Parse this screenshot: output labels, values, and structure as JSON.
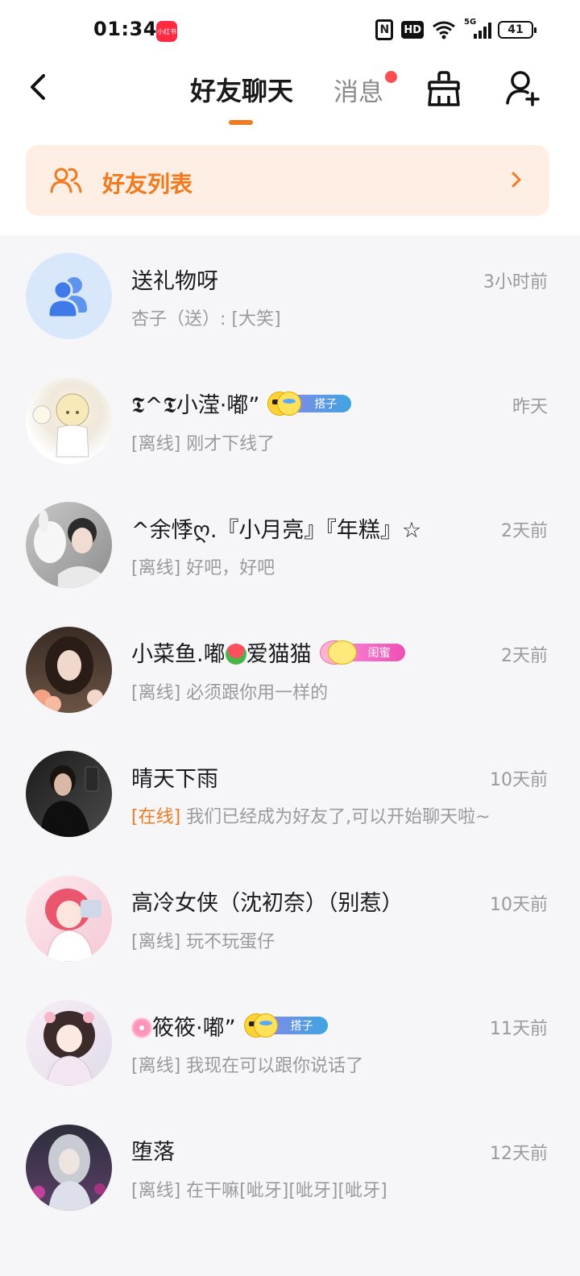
{
  "status_bar": {
    "time": "01:34",
    "app_icon_label": "小红书",
    "nfc": "N",
    "hd": "HD",
    "network": "5G",
    "battery": "41"
  },
  "header": {
    "active_tab": "好友聊天",
    "messages_tab": "消息",
    "has_unread": true
  },
  "banner": {
    "label": "好友列表"
  },
  "chats": [
    {
      "name": "送礼物呀",
      "time": "3小时前",
      "status": "",
      "preview": "杏子（送）: [大笑]",
      "avatar": "group-icon"
    },
    {
      "name": "𝕿^𝕿小滢·嘟”",
      "time": "昨天",
      "status": "[离线]",
      "preview": "刚才下线了",
      "badge": "搭子"
    },
    {
      "name": "^余悸ღ.『小月亮』『年糕』☆",
      "time": "2天前",
      "status": "[离线]",
      "preview": "好吧，好吧"
    },
    {
      "name_pre": "小菜鱼.嘟",
      "name_post": "爱猫猫",
      "time": "2天前",
      "status": "[离线]",
      "preview": "必须跟你用一样的",
      "badge": "闺蜜"
    },
    {
      "name": "晴天下雨",
      "time": "10天前",
      "status": "[在线]",
      "preview": "我们已经成为好友了,可以开始聊天啦~"
    },
    {
      "name": "高冷女侠（沈初奈）（别惹）",
      "time": "10天前",
      "status": "[离线]",
      "preview": "玩不玩蛋仔"
    },
    {
      "name": "筱筱·嘟”",
      "time": "11天前",
      "status": "[离线]",
      "preview": "我现在可以跟你说话了",
      "badge": "搭子"
    },
    {
      "name": "堕落",
      "time": "12天前",
      "status": "[离线]",
      "preview": "在干嘛[呲牙][呲牙][呲牙]"
    }
  ],
  "colors": {
    "accent": "#f07a1d",
    "banner_bg": "#ffeee3",
    "unread_dot": "#fe4d4f",
    "list_bg": "#f6f6f8"
  }
}
